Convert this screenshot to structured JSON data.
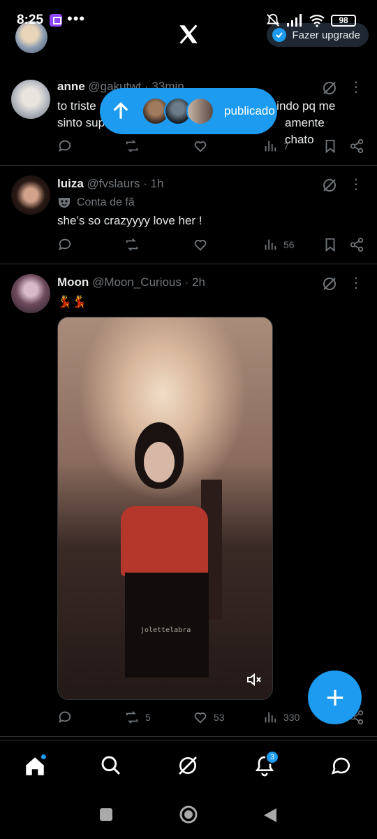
{
  "status_bar": {
    "time": "8:25",
    "battery": "98"
  },
  "header": {
    "upgrade_label": "Fazer upgrade"
  },
  "posted_pill": {
    "label": "publicado"
  },
  "posts": [
    {
      "name": "anne",
      "handle": "@gakutwt",
      "time": "33min",
      "text_line1": "to triste sem saber se eu chorei ou se vo ficar indo pq me",
      "text_line2": "sinto super ... tô ficando extremamente chato",
      "text_left1": "to triste",
      "text_right1": "a indo pq me",
      "text_left2": "sinto sup",
      "text_right2": "amente chato",
      "views": "7"
    },
    {
      "name": "luiza",
      "handle": "@fvslaurs",
      "time": "1h",
      "label": "Conta de fã",
      "text": "she’s so crazyyyy love her !",
      "views": "56"
    },
    {
      "name": "Moon",
      "handle": "@Moon_Curious",
      "time": "2h",
      "text": "💃💃",
      "video_watermark": "jolettelabra",
      "retweets": "5",
      "likes": "53",
      "views": "330"
    }
  ],
  "bottom_nav": {
    "notifications_badge": "3"
  },
  "colors": {
    "accent": "#1d9bf0",
    "background": "#000000",
    "muted": "#71767b",
    "divider": "#2f3336"
  }
}
